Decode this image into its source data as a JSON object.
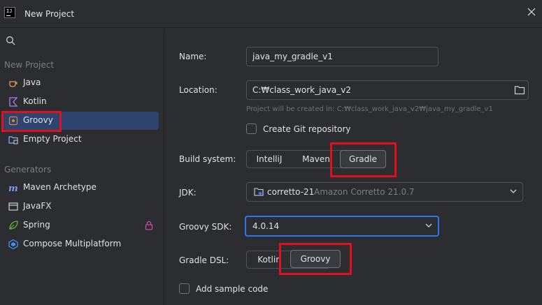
{
  "window": {
    "title": "New Project"
  },
  "sidebar": {
    "section_new": "New Project",
    "items": [
      {
        "label": "Java",
        "icon": "java-cup-icon"
      },
      {
        "label": "Kotlin",
        "icon": "kotlin-icon"
      },
      {
        "label": "Groovy",
        "icon": "groovy-icon"
      },
      {
        "label": "Empty Project",
        "icon": "empty-project-icon"
      }
    ],
    "section_generators": "Generators",
    "generators": [
      {
        "label": "Maven Archetype",
        "icon": "maven-icon"
      },
      {
        "label": "JavaFX",
        "icon": "javafx-icon"
      },
      {
        "label": "Spring",
        "icon": "spring-icon"
      },
      {
        "label": "Compose Multiplatform",
        "icon": "compose-icon"
      }
    ]
  },
  "form": {
    "name_label": "Name:",
    "name_value": "java_my_gradle_v1",
    "location_label": "Location:",
    "location_value": "C:₩class_work_java_v2",
    "location_hint": "Project will be created in: C:₩class_work_java_v2₩java_my_gradle_v1",
    "git_label": "Create Git repository",
    "build_label": "Build system:",
    "build_options": [
      "IntelliJ",
      "Maven",
      "Gradle"
    ],
    "build_selected": "Gradle",
    "jdk_label": "JDK:",
    "jdk_name": "corretto-21",
    "jdk_detail": "Amazon Corretto 21.0.7",
    "groovy_sdk_label": "Groovy SDK:",
    "groovy_sdk_value": "4.0.14",
    "dsl_label": "Gradle DSL:",
    "dsl_options": [
      "Kotlin",
      "Groovy"
    ],
    "dsl_selected": "Groovy",
    "sample_label": "Add sample code"
  },
  "colors": {
    "background": "#2b2d30",
    "selection": "#2e436e",
    "focus": "#3574f0",
    "highlight_box": "#e0101e"
  }
}
